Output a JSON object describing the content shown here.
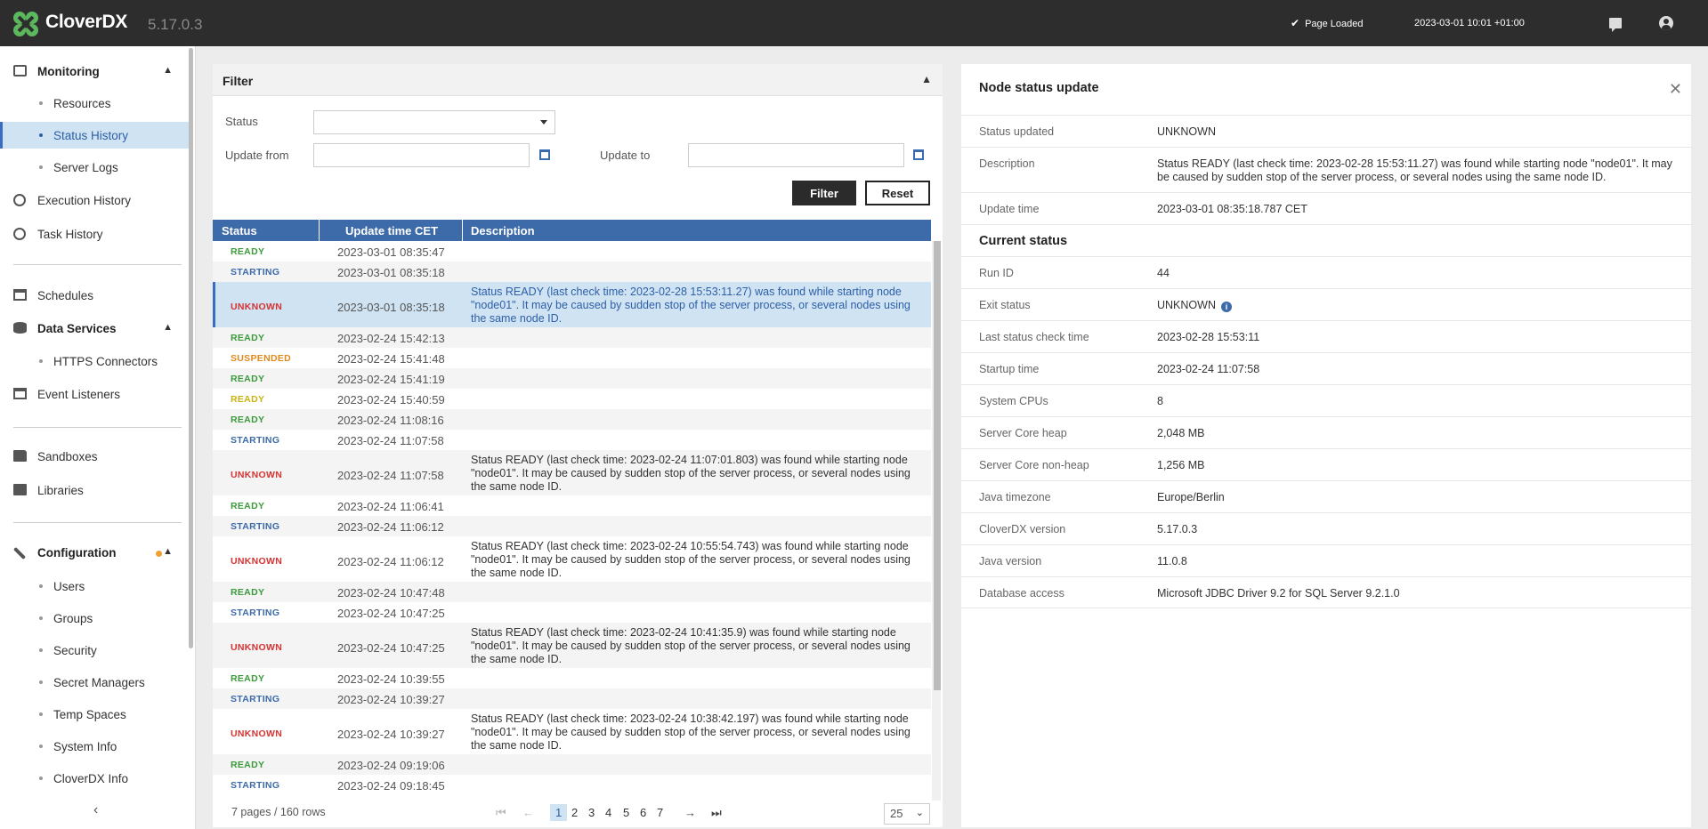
{
  "app": {
    "name": "CloverDX",
    "version": "5.17.0.3",
    "page_status": "Page Loaded",
    "datetime": "2023-03-01 10:01 +01:00",
    "accent": "#3d6aa8"
  },
  "sidebar": {
    "monitoring": "Monitoring",
    "resources": "Resources",
    "status_history": "Status History",
    "server_logs": "Server Logs",
    "execution_history": "Execution History",
    "task_history": "Task History",
    "schedules": "Schedules",
    "data_services": "Data Services",
    "https_connectors": "HTTPS Connectors",
    "event_listeners": "Event Listeners",
    "sandboxes": "Sandboxes",
    "libraries": "Libraries",
    "configuration": "Configuration",
    "users": "Users",
    "groups": "Groups",
    "security": "Security",
    "secret_managers": "Secret Managers",
    "temp_spaces": "Temp Spaces",
    "system_info": "System Info",
    "cloverdx_info": "CloverDX Info"
  },
  "filter": {
    "title": "Filter",
    "status_label": "Status",
    "status_value": "",
    "update_from_label": "Update from",
    "update_from_value": "",
    "update_to_label": "Update to",
    "update_to_value": "",
    "filter_button": "Filter",
    "reset_button": "Reset"
  },
  "table": {
    "columns": [
      "Status",
      "Update time CET",
      "Description"
    ],
    "rows": [
      {
        "status": "READY",
        "time": "2023-03-01 08:35:47",
        "desc": ""
      },
      {
        "status": "STARTING",
        "time": "2023-03-01 08:35:18",
        "desc": ""
      },
      {
        "status": "UNKNOWN",
        "time": "2023-03-01 08:35:18",
        "desc": "Status READY (last check time: 2023-02-28 15:53:11.27) was found while starting node \"node01\". It may be caused by sudden stop of the server process, or several nodes using the same node ID."
      },
      {
        "status": "READY",
        "time": "2023-02-24 15:42:13",
        "desc": ""
      },
      {
        "status": "SUSPENDED",
        "time": "2023-02-24 15:41:48",
        "desc": ""
      },
      {
        "status": "READY",
        "time": "2023-02-24 15:41:19",
        "desc": ""
      },
      {
        "status": "READY",
        "time": "2023-02-24 15:40:59",
        "desc": ""
      },
      {
        "status": "READY",
        "time": "2023-02-24 11:08:16",
        "desc": ""
      },
      {
        "status": "STARTING",
        "time": "2023-02-24 11:07:58",
        "desc": ""
      },
      {
        "status": "UNKNOWN",
        "time": "2023-02-24 11:07:58",
        "desc": "Status READY (last check time: 2023-02-24 11:07:01.803) was found while starting node \"node01\". It may be caused by sudden stop of the server process, or several nodes using the same node ID."
      },
      {
        "status": "READY",
        "time": "2023-02-24 11:06:41",
        "desc": ""
      },
      {
        "status": "STARTING",
        "time": "2023-02-24 11:06:12",
        "desc": ""
      },
      {
        "status": "UNKNOWN",
        "time": "2023-02-24 11:06:12",
        "desc": "Status READY (last check time: 2023-02-24 10:55:54.743) was found while starting node \"node01\". It may be caused by sudden stop of the server process, or several nodes using the same node ID."
      },
      {
        "status": "READY",
        "time": "2023-02-24 10:47:48",
        "desc": ""
      },
      {
        "status": "STARTING",
        "time": "2023-02-24 10:47:25",
        "desc": ""
      },
      {
        "status": "UNKNOWN",
        "time": "2023-02-24 10:47:25",
        "desc": "Status READY (last check time: 2023-02-24 10:41:35.9) was found while starting node \"node01\". It may be caused by sudden stop of the server process, or several nodes using the same node ID."
      },
      {
        "status": "READY",
        "time": "2023-02-24 10:39:55",
        "desc": ""
      },
      {
        "status": "STARTING",
        "time": "2023-02-24 10:39:27",
        "desc": ""
      },
      {
        "status": "UNKNOWN",
        "time": "2023-02-24 10:39:27",
        "desc": "Status READY (last check time: 2023-02-24 10:38:42.197) was found while starting node \"node01\". It may be caused by sudden stop of the server process, or several nodes using the same node ID."
      },
      {
        "status": "READY",
        "time": "2023-02-24 09:19:06",
        "desc": ""
      },
      {
        "status": "STARTING",
        "time": "2023-02-24 09:18:45",
        "desc": ""
      }
    ]
  },
  "pager": {
    "info": "7 pages / 160 rows",
    "pages": [
      "1",
      "2",
      "3",
      "4",
      "5",
      "6",
      "7"
    ],
    "current": "1",
    "page_size": "25"
  },
  "detail": {
    "title": "Node status update",
    "status_updated_label": "Status updated",
    "status_updated": "UNKNOWN",
    "description_label": "Description",
    "description": "Status READY (last check time: 2023-02-28 15:53:11.27) was found while starting node \"node01\". It may be caused by sudden stop of the server process, or several nodes using the same node ID.",
    "update_time_label": "Update time",
    "update_time": "2023-03-01 08:35:18.787 CET",
    "current_status": "Current status",
    "run_id_label": "Run ID",
    "run_id": "44",
    "exit_status_label": "Exit status",
    "exit_status": "UNKNOWN",
    "last_check_label": "Last status check time",
    "last_check": "2023-02-28 15:53:11",
    "startup_label": "Startup time",
    "startup": "2023-02-24 11:07:58",
    "cpus_label": "System CPUs",
    "cpus": "8",
    "heap_label": "Server Core heap",
    "heap": "2,048 MB",
    "nonheap_label": "Server Core non-heap",
    "nonheap": "1,256 MB",
    "tz_label": "Java timezone",
    "tz": "Europe/Berlin",
    "cdx_version_label": "CloverDX version",
    "cdx_version": "5.17.0.3",
    "java_version_label": "Java version",
    "java_version": "11.0.8",
    "db_label": "Database access",
    "db": "Microsoft JDBC Driver 9.2 for SQL Server 9.2.1.0"
  }
}
